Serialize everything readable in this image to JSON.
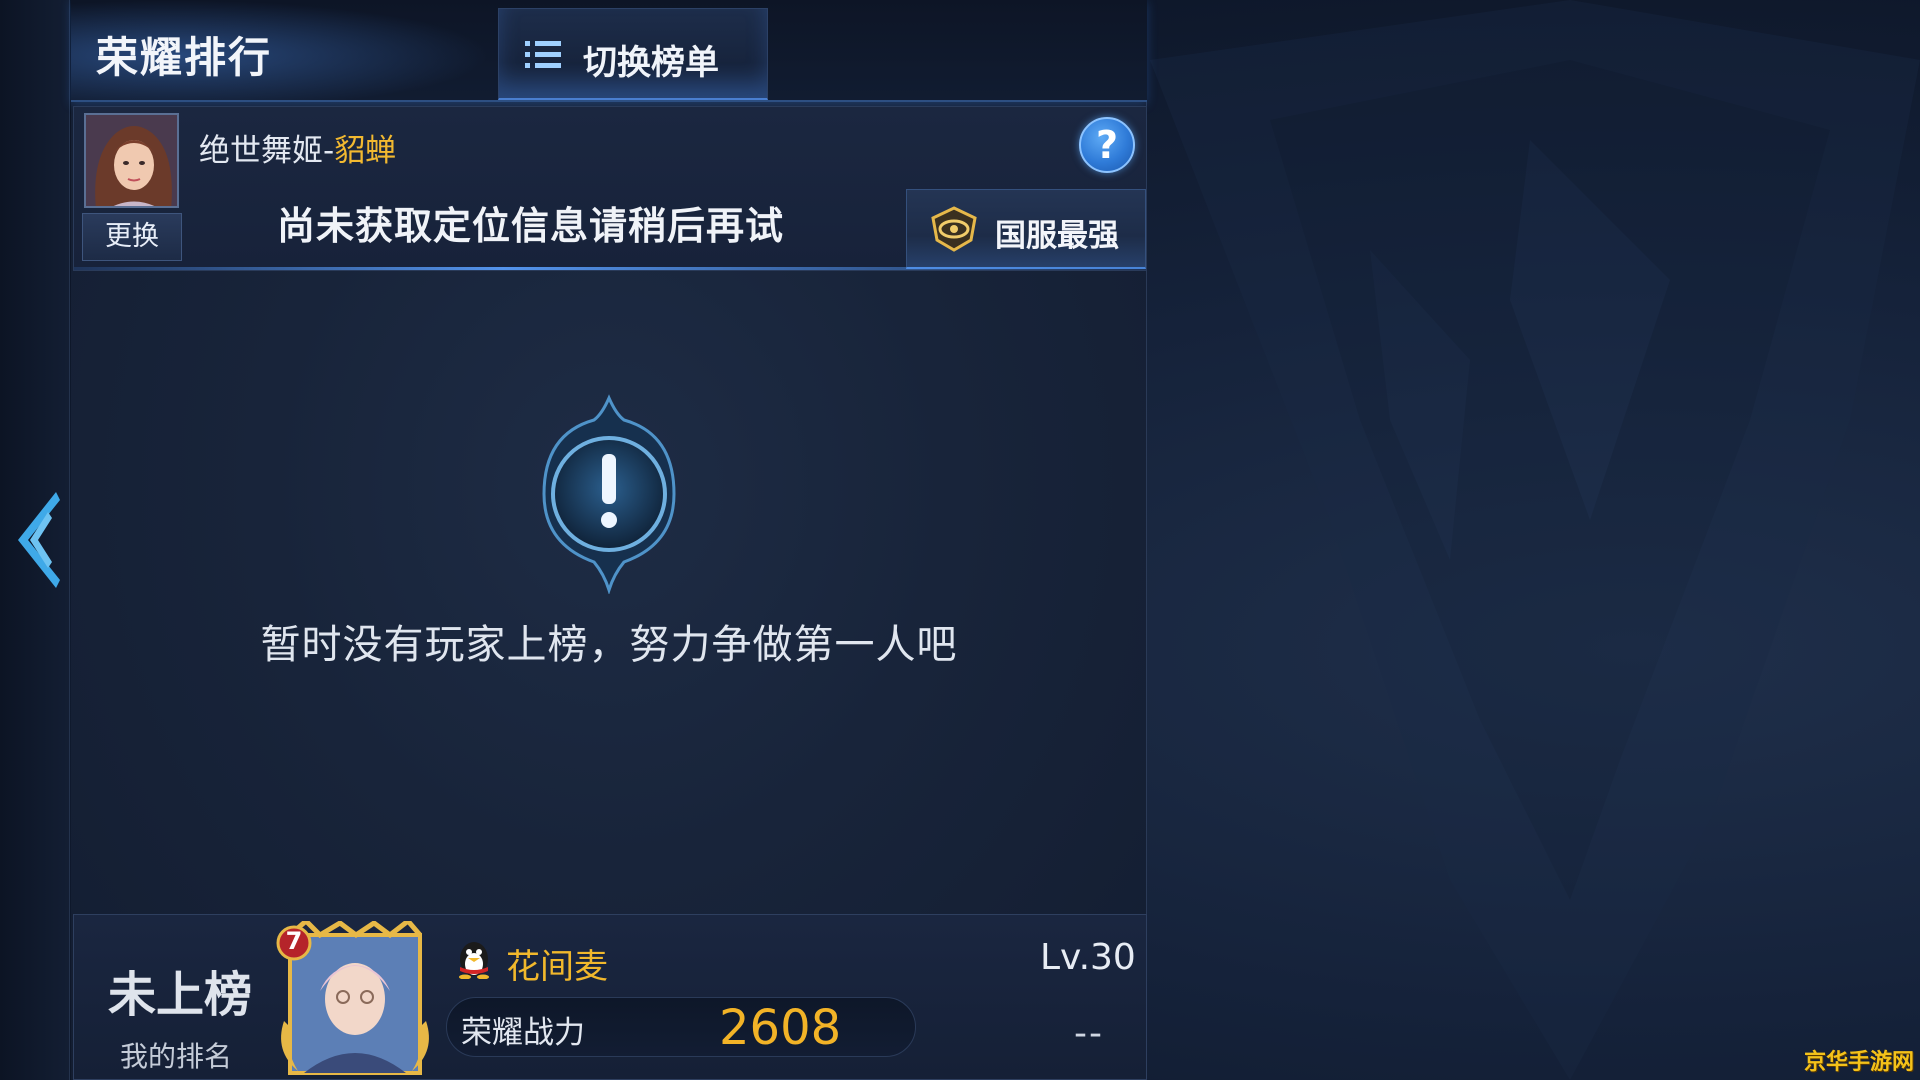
{
  "header": {
    "title": "荣耀排行",
    "switch_label": "切换榜单"
  },
  "profile": {
    "hero_prefix": "绝世舞姬",
    "hero_sep": "-",
    "hero_name": "貂蝉",
    "change_label": "更换",
    "location_message": "尚未获取定位信息请稍后再试",
    "help_symbol": "?",
    "region_label": "国服最强"
  },
  "empty_state": {
    "message": "暂时没有玩家上榜，努力争做第一人吧"
  },
  "my_rank": {
    "status": "未上榜",
    "caption": "我的排名",
    "avatar_badge": "7",
    "player_name": "花间麦",
    "level": "Lv.30",
    "power_label": "荣耀战力",
    "power_value": "2608",
    "rank_change": "--"
  },
  "watermark": "京华手游网",
  "icons": {
    "back": "chevron-double-left-icon",
    "switch": "list-icon",
    "help": "question-icon",
    "region": "eye-emblem-icon",
    "alert": "exclamation-icon",
    "qq": "qq-penguin-icon"
  },
  "colors": {
    "accent_gold": "#f2b327",
    "accent_blue": "#4a86d8",
    "help_blue": "#2f7bd8"
  }
}
